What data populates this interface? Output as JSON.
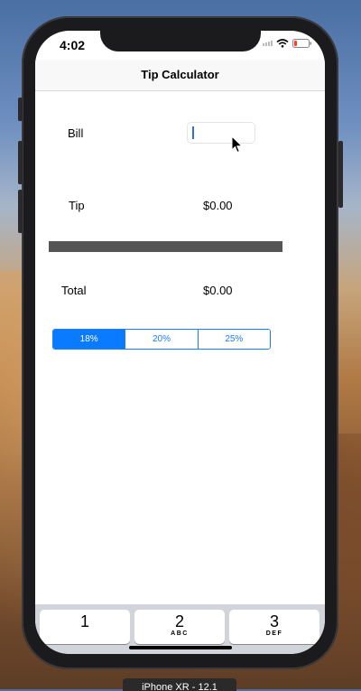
{
  "status_bar": {
    "time": "4:02"
  },
  "navbar": {
    "title": "Tip Calculator"
  },
  "bill": {
    "label": "Bill",
    "value": ""
  },
  "tip": {
    "label": "Tip",
    "value": "$0.00"
  },
  "total": {
    "label": "Total",
    "value": "$0.00"
  },
  "tip_selector": {
    "options": [
      "18%",
      "20%",
      "25%"
    ],
    "selected": "18%"
  },
  "keyboard": {
    "keys": [
      {
        "number": "1",
        "letters": ""
      },
      {
        "number": "2",
        "letters": "ABC"
      },
      {
        "number": "3",
        "letters": "DEF"
      }
    ]
  },
  "simulator": {
    "device_label": "iPhone XR - 12.1"
  },
  "colors": {
    "accent": "#0a7aff",
    "divider": "#555555"
  }
}
